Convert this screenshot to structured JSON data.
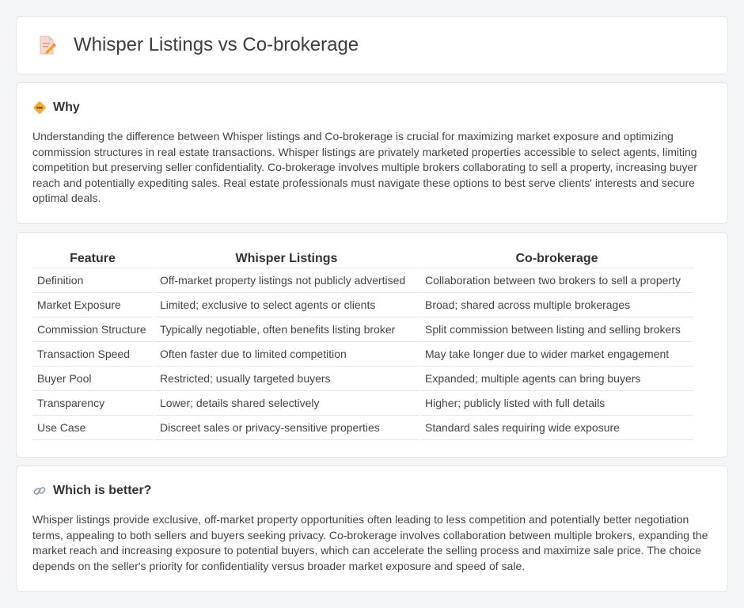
{
  "header": {
    "title": "Whisper Listings vs Co-brokerage",
    "icon": "document-pencil-icon"
  },
  "why": {
    "icon": "diamond-warning-icon",
    "title": "Why",
    "text": "Understanding the difference between Whisper listings and Co-brokerage is crucial for maximizing market exposure and optimizing commission structures in real estate transactions. Whisper listings are privately marketed properties accessible to select agents, limiting competition but preserving seller confidentiality. Co-brokerage involves multiple brokers collaborating to sell a property, increasing buyer reach and potentially expediting sales. Real estate professionals must navigate these options to best serve clients' interests and secure optimal deals."
  },
  "comparison": {
    "headers": [
      "Feature",
      "Whisper Listings",
      "Co-brokerage"
    ],
    "rows": [
      [
        "Definition",
        "Off-market property listings not publicly advertised",
        "Collaboration between two brokers to sell a property"
      ],
      [
        "Market Exposure",
        "Limited; exclusive to select agents or clients",
        "Broad; shared across multiple brokerages"
      ],
      [
        "Commission Structure",
        "Typically negotiable, often benefits listing broker",
        "Split commission between listing and selling brokers"
      ],
      [
        "Transaction Speed",
        "Often faster due to limited competition",
        "May take longer due to wider market engagement"
      ],
      [
        "Buyer Pool",
        "Restricted; usually targeted buyers",
        "Expanded; multiple agents can bring buyers"
      ],
      [
        "Transparency",
        "Lower; details shared selectively",
        "Higher; publicly listed with full details"
      ],
      [
        "Use Case",
        "Discreet sales or privacy-sensitive properties",
        "Standard sales requiring wide exposure"
      ]
    ]
  },
  "better": {
    "icon": "link-icon",
    "title": "Which is better?",
    "text": "Whisper listings provide exclusive, off-market property opportunities often leading to less competition and potentially better negotiation terms, appealing to both sellers and buyers seeking privacy. Co-brokerage involves collaboration between multiple brokers, expanding the market reach and increasing exposure to potential buyers, which can accelerate the selling process and maximize sale price. The choice depends on the seller's priority for confidentiality versus broader market exposure and speed of sale."
  }
}
